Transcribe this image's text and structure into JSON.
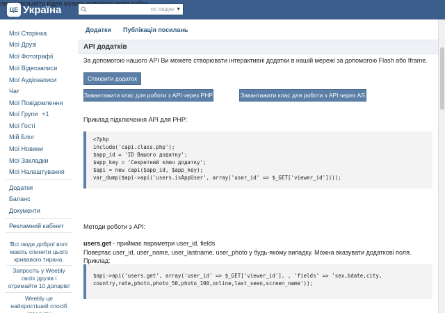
{
  "header": {
    "logo_badge": "ЦЕ",
    "logo_text": "Україна",
    "search_scope": "по людях",
    "nav": [
      "люди",
      "спільноти",
      "відео",
      "музика",
      "допомога",
      "мова",
      "вийти"
    ]
  },
  "sidebar": {
    "items": [
      {
        "label": "Мої Сторінка"
      },
      {
        "label": "Мої Друзі"
      },
      {
        "label": "Мої Фотографії"
      },
      {
        "label": "Мої Відеозаписи"
      },
      {
        "label": "Мої Аудіозаписи"
      },
      {
        "label": "Чат"
      },
      {
        "label": "Мої Повідомлення"
      },
      {
        "label": "Мої Групи",
        "count": "+1"
      },
      {
        "label": "Мої Гості"
      },
      {
        "label": "Мій Блог"
      },
      {
        "label": "Мої Новини"
      },
      {
        "label": "Мої Закладки"
      },
      {
        "label": "Мої Налаштування"
      }
    ],
    "extra": [
      "Додатки",
      "Баланс",
      "Документи"
    ],
    "ads": "Рекламний кабінет",
    "promo1": "Всі люди доброї волі мають спинити цього кривавого тирана.",
    "promo2": "Запросіть у Weebly своїх друзів і отримайте 10 доларів!",
    "promo3": "Weebly це найпростіший спосіб створити"
  },
  "tabs": [
    "Додатки",
    "Публікація посилань"
  ],
  "page": {
    "title": "API додатків",
    "intro": "За допомогою нашого API Ви можете створювати інтерактивні додатки в нашій мережі за допомогою Flash або Iframe.",
    "create_button": "Створити додаток",
    "download_php": "Завантажити клас для роботи з API через PHP",
    "download_as": "Завантажити клас для роботи з API через AS",
    "example_label": "Приклад підключення API для PHP:",
    "php_code": "<?php\ninclude('capi.class.php');\n$app_id = 'ID Вашого додатку';\n$app_key = 'Секретний ключ додатку';\n$api = new capi($app_id, $app_key);\nvar_dump($api->api('users.isAppUser', array('user_id' => $_GET['viewer_id'])));",
    "methods_label": "Методи роботи з API:",
    "method_name": "users.get",
    "method_desc": " - приймає параметри user_id, fields",
    "method_returns": "Повертає user_id, user_name, user_lastname, user_photo у будь-якому випадку. Можна вказувати додаткові поля.",
    "example2_label": "Приклад:",
    "example2_code": "$api->api('users.get', array('user_id' => $_GET['viewer_id'], , 'fields' => 'sex,bdate,city,\ncountry,rate,photo,photo_50,photo_100,online,last_seen,screen_name'));"
  }
}
